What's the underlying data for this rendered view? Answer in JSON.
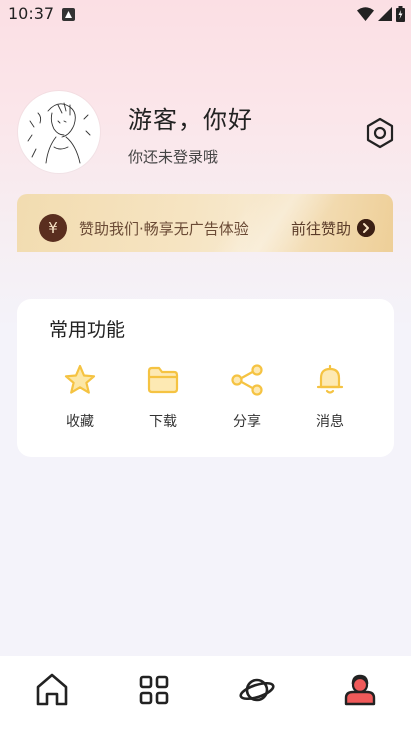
{
  "status_bar": {
    "time": "10:37"
  },
  "profile": {
    "greeting": "游客，你好",
    "subtitle": "你还未登录哦",
    "avatar_icon": "sketch-avatar"
  },
  "sponsor": {
    "icon": "¥",
    "text": "赞助我们·畅享无广告体验",
    "link": "前往赞助"
  },
  "features": {
    "title": "常用功能",
    "items": [
      {
        "label": "收藏",
        "icon": "star-icon"
      },
      {
        "label": "下载",
        "icon": "folder-icon"
      },
      {
        "label": "分享",
        "icon": "share-icon"
      },
      {
        "label": "消息",
        "icon": "bell-icon"
      }
    ]
  },
  "tabbar": {
    "items": [
      {
        "icon": "home-icon"
      },
      {
        "icon": "grid-icon"
      },
      {
        "icon": "planet-icon"
      },
      {
        "icon": "profile-icon",
        "active": true
      }
    ]
  },
  "colors": {
    "accent_yellow": "#f5c342",
    "tab_active": "#f05a5a",
    "sponsor_dark": "#5a2e1f"
  }
}
